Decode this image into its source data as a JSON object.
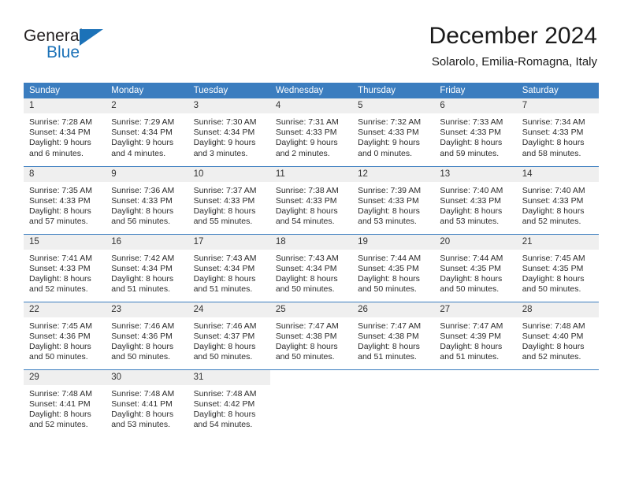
{
  "brand": {
    "name_top": "General",
    "name_bottom": "Blue",
    "triangle_icon": "triangle-icon",
    "color_dark": "#231f20",
    "color_blue": "#1c72b8"
  },
  "header": {
    "title": "December 2024",
    "subtitle": "Solarolo, Emilia-Romagna, Italy"
  },
  "theme": {
    "header_row_bg": "#3b7dbf",
    "header_row_text": "#ffffff",
    "daynum_bg": "#efefef",
    "cell_bg": "#ffffff",
    "row_divider": "#3b7dbf"
  },
  "calendar": {
    "weekday_headers": [
      "Sunday",
      "Monday",
      "Tuesday",
      "Wednesday",
      "Thursday",
      "Friday",
      "Saturday"
    ],
    "labels": {
      "sunrise": "Sunrise:",
      "sunset": "Sunset:",
      "daylight": "Daylight:"
    },
    "weeks": [
      [
        {
          "day": "1",
          "sunrise": "Sunrise: 7:28 AM",
          "sunset": "Sunset: 4:34 PM",
          "daylight_1": "Daylight: 9 hours",
          "daylight_2": "and 6 minutes."
        },
        {
          "day": "2",
          "sunrise": "Sunrise: 7:29 AM",
          "sunset": "Sunset: 4:34 PM",
          "daylight_1": "Daylight: 9 hours",
          "daylight_2": "and 4 minutes."
        },
        {
          "day": "3",
          "sunrise": "Sunrise: 7:30 AM",
          "sunset": "Sunset: 4:34 PM",
          "daylight_1": "Daylight: 9 hours",
          "daylight_2": "and 3 minutes."
        },
        {
          "day": "4",
          "sunrise": "Sunrise: 7:31 AM",
          "sunset": "Sunset: 4:33 PM",
          "daylight_1": "Daylight: 9 hours",
          "daylight_2": "and 2 minutes."
        },
        {
          "day": "5",
          "sunrise": "Sunrise: 7:32 AM",
          "sunset": "Sunset: 4:33 PM",
          "daylight_1": "Daylight: 9 hours",
          "daylight_2": "and 0 minutes."
        },
        {
          "day": "6",
          "sunrise": "Sunrise: 7:33 AM",
          "sunset": "Sunset: 4:33 PM",
          "daylight_1": "Daylight: 8 hours",
          "daylight_2": "and 59 minutes."
        },
        {
          "day": "7",
          "sunrise": "Sunrise: 7:34 AM",
          "sunset": "Sunset: 4:33 PM",
          "daylight_1": "Daylight: 8 hours",
          "daylight_2": "and 58 minutes."
        }
      ],
      [
        {
          "day": "8",
          "sunrise": "Sunrise: 7:35 AM",
          "sunset": "Sunset: 4:33 PM",
          "daylight_1": "Daylight: 8 hours",
          "daylight_2": "and 57 minutes."
        },
        {
          "day": "9",
          "sunrise": "Sunrise: 7:36 AM",
          "sunset": "Sunset: 4:33 PM",
          "daylight_1": "Daylight: 8 hours",
          "daylight_2": "and 56 minutes."
        },
        {
          "day": "10",
          "sunrise": "Sunrise: 7:37 AM",
          "sunset": "Sunset: 4:33 PM",
          "daylight_1": "Daylight: 8 hours",
          "daylight_2": "and 55 minutes."
        },
        {
          "day": "11",
          "sunrise": "Sunrise: 7:38 AM",
          "sunset": "Sunset: 4:33 PM",
          "daylight_1": "Daylight: 8 hours",
          "daylight_2": "and 54 minutes."
        },
        {
          "day": "12",
          "sunrise": "Sunrise: 7:39 AM",
          "sunset": "Sunset: 4:33 PM",
          "daylight_1": "Daylight: 8 hours",
          "daylight_2": "and 53 minutes."
        },
        {
          "day": "13",
          "sunrise": "Sunrise: 7:40 AM",
          "sunset": "Sunset: 4:33 PM",
          "daylight_1": "Daylight: 8 hours",
          "daylight_2": "and 53 minutes."
        },
        {
          "day": "14",
          "sunrise": "Sunrise: 7:40 AM",
          "sunset": "Sunset: 4:33 PM",
          "daylight_1": "Daylight: 8 hours",
          "daylight_2": "and 52 minutes."
        }
      ],
      [
        {
          "day": "15",
          "sunrise": "Sunrise: 7:41 AM",
          "sunset": "Sunset: 4:33 PM",
          "daylight_1": "Daylight: 8 hours",
          "daylight_2": "and 52 minutes."
        },
        {
          "day": "16",
          "sunrise": "Sunrise: 7:42 AM",
          "sunset": "Sunset: 4:34 PM",
          "daylight_1": "Daylight: 8 hours",
          "daylight_2": "and 51 minutes."
        },
        {
          "day": "17",
          "sunrise": "Sunrise: 7:43 AM",
          "sunset": "Sunset: 4:34 PM",
          "daylight_1": "Daylight: 8 hours",
          "daylight_2": "and 51 minutes."
        },
        {
          "day": "18",
          "sunrise": "Sunrise: 7:43 AM",
          "sunset": "Sunset: 4:34 PM",
          "daylight_1": "Daylight: 8 hours",
          "daylight_2": "and 50 minutes."
        },
        {
          "day": "19",
          "sunrise": "Sunrise: 7:44 AM",
          "sunset": "Sunset: 4:35 PM",
          "daylight_1": "Daylight: 8 hours",
          "daylight_2": "and 50 minutes."
        },
        {
          "day": "20",
          "sunrise": "Sunrise: 7:44 AM",
          "sunset": "Sunset: 4:35 PM",
          "daylight_1": "Daylight: 8 hours",
          "daylight_2": "and 50 minutes."
        },
        {
          "day": "21",
          "sunrise": "Sunrise: 7:45 AM",
          "sunset": "Sunset: 4:35 PM",
          "daylight_1": "Daylight: 8 hours",
          "daylight_2": "and 50 minutes."
        }
      ],
      [
        {
          "day": "22",
          "sunrise": "Sunrise: 7:45 AM",
          "sunset": "Sunset: 4:36 PM",
          "daylight_1": "Daylight: 8 hours",
          "daylight_2": "and 50 minutes."
        },
        {
          "day": "23",
          "sunrise": "Sunrise: 7:46 AM",
          "sunset": "Sunset: 4:36 PM",
          "daylight_1": "Daylight: 8 hours",
          "daylight_2": "and 50 minutes."
        },
        {
          "day": "24",
          "sunrise": "Sunrise: 7:46 AM",
          "sunset": "Sunset: 4:37 PM",
          "daylight_1": "Daylight: 8 hours",
          "daylight_2": "and 50 minutes."
        },
        {
          "day": "25",
          "sunrise": "Sunrise: 7:47 AM",
          "sunset": "Sunset: 4:38 PM",
          "daylight_1": "Daylight: 8 hours",
          "daylight_2": "and 50 minutes."
        },
        {
          "day": "26",
          "sunrise": "Sunrise: 7:47 AM",
          "sunset": "Sunset: 4:38 PM",
          "daylight_1": "Daylight: 8 hours",
          "daylight_2": "and 51 minutes."
        },
        {
          "day": "27",
          "sunrise": "Sunrise: 7:47 AM",
          "sunset": "Sunset: 4:39 PM",
          "daylight_1": "Daylight: 8 hours",
          "daylight_2": "and 51 minutes."
        },
        {
          "day": "28",
          "sunrise": "Sunrise: 7:48 AM",
          "sunset": "Sunset: 4:40 PM",
          "daylight_1": "Daylight: 8 hours",
          "daylight_2": "and 52 minutes."
        }
      ],
      [
        {
          "day": "29",
          "sunrise": "Sunrise: 7:48 AM",
          "sunset": "Sunset: 4:41 PM",
          "daylight_1": "Daylight: 8 hours",
          "daylight_2": "and 52 minutes."
        },
        {
          "day": "30",
          "sunrise": "Sunrise: 7:48 AM",
          "sunset": "Sunset: 4:41 PM",
          "daylight_1": "Daylight: 8 hours",
          "daylight_2": "and 53 minutes."
        },
        {
          "day": "31",
          "sunrise": "Sunrise: 7:48 AM",
          "sunset": "Sunset: 4:42 PM",
          "daylight_1": "Daylight: 8 hours",
          "daylight_2": "and 54 minutes."
        },
        {
          "day": "",
          "sunrise": "",
          "sunset": "",
          "daylight_1": "",
          "daylight_2": ""
        },
        {
          "day": "",
          "sunrise": "",
          "sunset": "",
          "daylight_1": "",
          "daylight_2": ""
        },
        {
          "day": "",
          "sunrise": "",
          "sunset": "",
          "daylight_1": "",
          "daylight_2": ""
        },
        {
          "day": "",
          "sunrise": "",
          "sunset": "",
          "daylight_1": "",
          "daylight_2": ""
        }
      ]
    ]
  }
}
